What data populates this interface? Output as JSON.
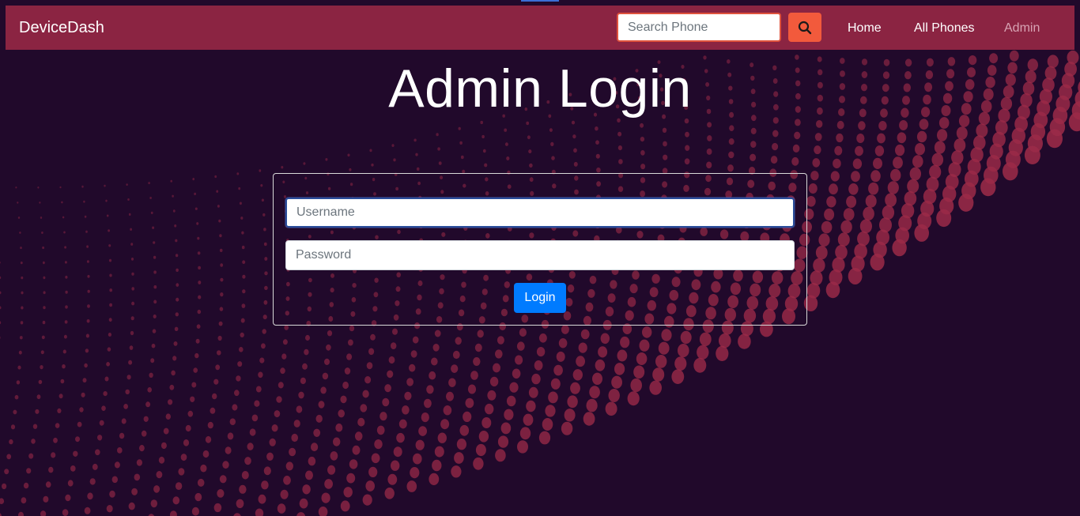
{
  "navbar": {
    "brand": "DeviceDash",
    "search": {
      "placeholder": "Search Phone",
      "value": ""
    },
    "search_button_icon": "search-icon",
    "links": [
      {
        "label": "Home",
        "active": false
      },
      {
        "label": "All Phones",
        "active": false
      },
      {
        "label": "Admin",
        "active": true
      }
    ]
  },
  "main": {
    "title": "Admin Login",
    "form": {
      "username_placeholder": "Username",
      "password_placeholder": "Password",
      "submit_label": "Login"
    }
  },
  "colors": {
    "background": "#21092b",
    "navbar": "#8b2442",
    "search_button": "#f25a3c",
    "login_button": "#007bff",
    "dots": "#9b2a48"
  }
}
